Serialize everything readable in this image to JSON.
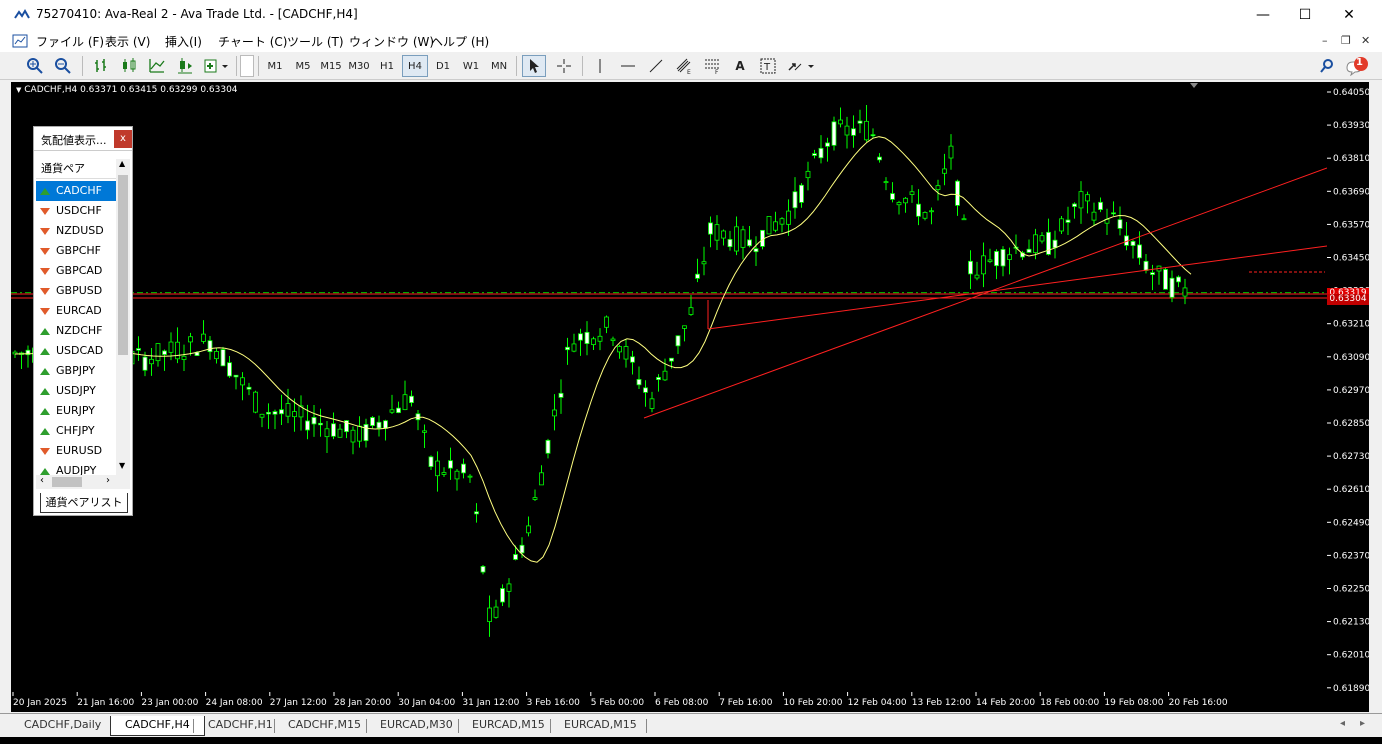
{
  "window": {
    "title": "75270410: Ava-Real 2 - Ava Trade Ltd. - [CADCHF,H4]",
    "minimize": "—",
    "maximize": "☐",
    "close": "✕"
  },
  "menu": {
    "items": [
      "ファイル (F)",
      "表示 (V)",
      "挿入(I)",
      "チャート (C)",
      "ツール (T)",
      "ウィンドウ (W)",
      "ヘルプ (H)"
    ],
    "mdi_min": "–",
    "mdi_restore": "❐",
    "mdi_close": "✕"
  },
  "toolbar": {
    "timeframes": [
      "M1",
      "M5",
      "M15",
      "M30",
      "H1",
      "H4",
      "D1",
      "W1",
      "MN"
    ],
    "active_timeframe": "H4",
    "notification_count": "1"
  },
  "chart": {
    "info": "CADCHF,H4  0.63371 0.63415 0.63299 0.63304",
    "current_price_tag": "0.63304",
    "bid_tag": "0.63319",
    "price_labels": [
      "0.64050",
      "0.63930",
      "0.63810",
      "0.63690",
      "0.63570",
      "0.63450",
      "0.63330",
      "0.63210",
      "0.63090",
      "0.62970",
      "0.62850",
      "0.62730",
      "0.62610",
      "0.62490",
      "0.62370",
      "0.62250",
      "0.62130",
      "0.62010",
      "0.61890"
    ],
    "time_labels": [
      "20 Jan 2025",
      "21 Jan 16:00",
      "23 Jan 00:00",
      "24 Jan 08:00",
      "27 Jan 12:00",
      "28 Jan 20:00",
      "30 Jan 04:00",
      "31 Jan 12:00",
      "3 Feb 16:00",
      "5 Feb 00:00",
      "6 Feb 08:00",
      "7 Feb 16:00",
      "10 Feb 20:00",
      "12 Feb 04:00",
      "13 Feb 12:00",
      "14 Feb 20:00",
      "18 Feb 00:00",
      "19 Feb 08:00",
      "20 Feb 16:00"
    ],
    "colors": {
      "bull": "#00ff00",
      "bear": "#ffffff",
      "ma": "#ffff80",
      "trend": "#ff2020",
      "grid_level": "#00c000"
    }
  },
  "market_watch": {
    "title": "気配値表示...",
    "close": "x",
    "column_header": "通貨ペア",
    "tab_label": "通貨ペアリスト",
    "rows": [
      {
        "symbol": "CADCHF",
        "dir": "up"
      },
      {
        "symbol": "USDCHF",
        "dir": "down"
      },
      {
        "symbol": "NZDUSD",
        "dir": "down"
      },
      {
        "symbol": "GBPCHF",
        "dir": "down"
      },
      {
        "symbol": "GBPCAD",
        "dir": "down"
      },
      {
        "symbol": "GBPUSD",
        "dir": "down"
      },
      {
        "symbol": "EURCAD",
        "dir": "down"
      },
      {
        "symbol": "NZDCHF",
        "dir": "up"
      },
      {
        "symbol": "USDCAD",
        "dir": "up"
      },
      {
        "symbol": "GBPJPY",
        "dir": "up"
      },
      {
        "symbol": "USDJPY",
        "dir": "up"
      },
      {
        "symbol": "EURJPY",
        "dir": "up"
      },
      {
        "symbol": "CHFJPY",
        "dir": "up"
      },
      {
        "symbol": "EURUSD",
        "dir": "down"
      },
      {
        "symbol": "AUDJPY",
        "dir": "up"
      }
    ]
  },
  "tabs": {
    "items": [
      "CADCHF,Daily",
      "CADCHF,H4",
      "CADCHF,H1",
      "CADCHF,M15",
      "EURCAD,M30",
      "EURCAD,M15",
      "EURCAD,M15"
    ],
    "active": "CADCHF,H4"
  }
}
